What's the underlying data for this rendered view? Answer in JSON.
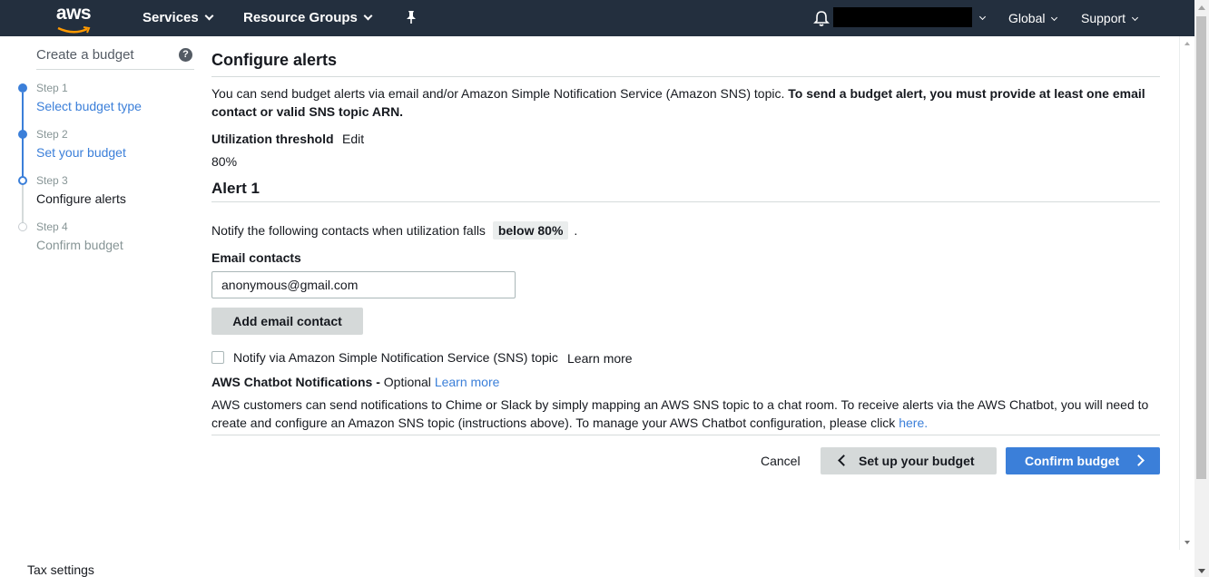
{
  "nav": {
    "logo": "aws",
    "services": "Services",
    "resource_groups": "Resource Groups",
    "region": "Global",
    "support": "Support",
    "icons": [
      "pin-icon",
      "bell-icon"
    ]
  },
  "sidebar": {
    "title": "Create a budget",
    "steps": [
      {
        "num": "Step 1",
        "name": "Select budget type",
        "state": "complete"
      },
      {
        "num": "Step 2",
        "name": "Set your budget",
        "state": "complete"
      },
      {
        "num": "Step 3",
        "name": "Configure alerts",
        "state": "current"
      },
      {
        "num": "Step 4",
        "name": "Confirm budget",
        "state": "upcoming"
      }
    ],
    "footer": "Tax settings"
  },
  "main": {
    "title": "Configure alerts",
    "intro": "You can send budget alerts via email and/or Amazon Simple Notification Service (Amazon SNS) topic. ",
    "intro_bold": "To send a budget alert, you must provide at least one email contact or valid SNS topic ARN.",
    "threshold_label": "Utilization threshold",
    "threshold_edit": "Edit",
    "threshold_value": "80%",
    "alert_title": "Alert 1",
    "notify_text": "Notify the following contacts when utilization falls",
    "notify_badge": "below 80%",
    "notify_period": ".",
    "email_label": "Email contacts",
    "email_value": "anonymous@gmail.com",
    "add_email": "Add email contact",
    "sns_label": "Notify via Amazon Simple Notification Service (SNS) topic",
    "sns_learn": "Learn more",
    "chatbot_label": "AWS Chatbot Notifications - ",
    "chatbot_optional": "Optional",
    "chatbot_learn": "Learn more",
    "chatbot_desc": "AWS customers can send notifications to Chime or Slack by simply mapping an AWS SNS topic to a chat room. To receive alerts via the AWS Chatbot, you will need to create and configure an Amazon SNS topic (instructions above). To manage your AWS Chatbot configuration, please click ",
    "chatbot_here": "here."
  },
  "footer_actions": {
    "cancel": "Cancel",
    "back": "Set up your budget",
    "confirm": "Confirm budget"
  },
  "colors": {
    "nav_bg": "#232f3e",
    "link": "#3b7fd9",
    "primary": "#3b7fd9"
  }
}
